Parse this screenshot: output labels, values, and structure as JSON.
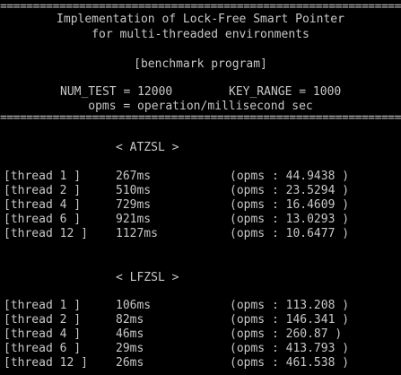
{
  "header": {
    "rule_top": "================================================================",
    "title_line1": "Implementation of Lock-Free Smart Pointer",
    "title_line2": "for multi-threaded environments",
    "subtitle": "[benchmark program]",
    "num_test": "NUM_TEST = 12000",
    "key_range": "KEY_RANGE = 1000",
    "opms_def": "opms = operation/millisecond sec",
    "rule_bottom": "================================================================"
  },
  "sections": [
    {
      "title": "< ATZSL >",
      "rows": [
        {
          "thread": "[thread 1 ]",
          "time": "267ms",
          "opms": "(opms : 44.9438 )"
        },
        {
          "thread": "[thread 2 ]",
          "time": "510ms",
          "opms": "(opms : 23.5294 )"
        },
        {
          "thread": "[thread 4 ]",
          "time": "729ms",
          "opms": "(opms : 16.4609 )"
        },
        {
          "thread": "[thread 6 ]",
          "time": "921ms",
          "opms": "(opms : 13.0293 )"
        },
        {
          "thread": "[thread 12 ]",
          "time": "1127ms",
          "opms": "(opms : 10.6477 )"
        }
      ]
    },
    {
      "title": "< LFZSL >",
      "rows": [
        {
          "thread": "[thread 1 ]",
          "time": "106ms",
          "opms": "(opms : 113.208 )"
        },
        {
          "thread": "[thread 2 ]",
          "time": "82ms",
          "opms": "(opms : 146.341 )"
        },
        {
          "thread": "[thread 4 ]",
          "time": "46ms",
          "opms": "(opms : 260.87 )"
        },
        {
          "thread": "[thread 6 ]",
          "time": "29ms",
          "opms": "(opms : 413.793 )"
        },
        {
          "thread": "[thread 12 ]",
          "time": "26ms",
          "opms": "(opms : 461.538 )"
        }
      ]
    }
  ]
}
